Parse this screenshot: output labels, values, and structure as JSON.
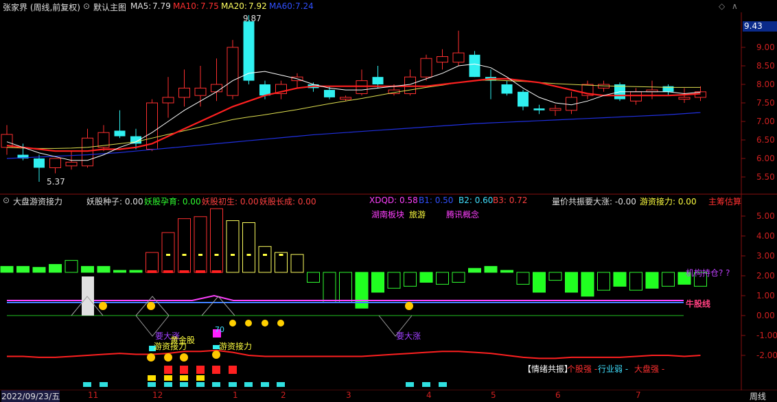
{
  "main_header": {
    "title": "张家界 (周线,前复权)",
    "chart_mode": "默认主图",
    "ma5_label": "MA5:",
    "ma5_value": "7.79",
    "ma10_label": "MA10:",
    "ma10_value": "7.75",
    "ma20_label": "MA20:",
    "ma20_value": "7.92",
    "ma60_label": "MA60:",
    "ma60_value": "7.24"
  },
  "price_axis": [
    "9.00",
    "8.50",
    "8.00",
    "7.50",
    "7.00",
    "6.50",
    "6.00",
    "5.50"
  ],
  "current_price_tag": "9.43",
  "annotations": {
    "high": "9.87",
    "low": "5.37"
  },
  "sub_header": {
    "indicator_name": "大盘游资接力",
    "yaogu_zhongzi": "妖股种子: 0.00",
    "yaogu_yunyu": "妖股孕育: 0.00",
    "yaogu_chusheng": "妖股初生: 0.00",
    "yaogu_zhangcheng": "妖股长成: 0.00",
    "xdqd": "XDQD: 0.58",
    "b1": "B1: 0.50",
    "b2": "B2: 0.60",
    "b3": "B3: 0.72",
    "liangjia": "量价共振要大涨: -0.00",
    "youzi": "游资接力: 0.00",
    "zhuchou": "主筹估算"
  },
  "sub_axis": [
    "5.00",
    "4.00",
    "3.00",
    "2.00",
    "1.00",
    "0.00",
    "-1.00",
    "-2.00"
  ],
  "sub_labels": {
    "hunan": "湖南板块",
    "lvyou": "旅游",
    "tengxun": "腾讯概念",
    "jigou": "机构持仓? ?",
    "niugu": "牛股线",
    "yaodazhang1": "要大涨",
    "yaodazhang2": "要大涨",
    "huangjin": "黄金股",
    "youzi1": "游资接力",
    "youzi2": "游资接力",
    "num70": "70",
    "qingxu": "【情绪共振】",
    "gegu": "个股强 -",
    "hangye": "行业弱 -",
    "dapan": "大盘强 -"
  },
  "time_axis": {
    "date": "2022/09/23/五",
    "ticks": [
      "11",
      "12",
      "1",
      "2",
      "3",
      "4",
      "5",
      "6",
      "7"
    ],
    "period": "周线"
  },
  "chart_data": {
    "type": "candlestick",
    "title": "张家界 (周线,前复权)",
    "ylim": [
      5.2,
      10.1
    ],
    "candles": [
      {
        "o": 6.3,
        "h": 6.9,
        "l": 6.1,
        "c": 6.65
      },
      {
        "o": 6.1,
        "h": 6.4,
        "l": 5.95,
        "c": 6.0
      },
      {
        "o": 6.0,
        "h": 6.1,
        "l": 5.37,
        "c": 5.75
      },
      {
        "o": 5.75,
        "h": 6.0,
        "l": 5.6,
        "c": 6.0
      },
      {
        "o": 5.8,
        "h": 6.2,
        "l": 5.7,
        "c": 5.9
      },
      {
        "o": 5.8,
        "h": 6.8,
        "l": 5.75,
        "c": 6.55
      },
      {
        "o": 6.3,
        "h": 6.9,
        "l": 6.2,
        "c": 6.7
      },
      {
        "o": 6.75,
        "h": 7.3,
        "l": 6.55,
        "c": 6.6
      },
      {
        "o": 6.6,
        "h": 6.8,
        "l": 6.25,
        "c": 6.4
      },
      {
        "o": 6.25,
        "h": 7.6,
        "l": 6.2,
        "c": 7.5
      },
      {
        "o": 7.5,
        "h": 8.2,
        "l": 7.1,
        "c": 7.65
      },
      {
        "o": 7.65,
        "h": 8.4,
        "l": 7.4,
        "c": 7.9
      },
      {
        "o": 7.7,
        "h": 8.5,
        "l": 7.4,
        "c": 7.9
      },
      {
        "o": 7.8,
        "h": 8.7,
        "l": 7.55,
        "c": 8.0
      },
      {
        "o": 7.7,
        "h": 9.2,
        "l": 7.6,
        "c": 9.0
      },
      {
        "o": 9.7,
        "h": 9.87,
        "l": 8.0,
        "c": 8.1
      },
      {
        "o": 8.0,
        "h": 8.1,
        "l": 7.6,
        "c": 7.7
      },
      {
        "o": 7.75,
        "h": 8.1,
        "l": 7.6,
        "c": 8.0
      },
      {
        "o": 8.1,
        "h": 8.3,
        "l": 7.9,
        "c": 8.2
      },
      {
        "o": 8.0,
        "h": 8.05,
        "l": 7.8,
        "c": 7.9
      },
      {
        "o": 7.85,
        "h": 7.95,
        "l": 7.6,
        "c": 7.65
      },
      {
        "o": 7.6,
        "h": 7.7,
        "l": 7.55,
        "c": 7.65
      },
      {
        "o": 7.75,
        "h": 8.4,
        "l": 7.7,
        "c": 8.1
      },
      {
        "o": 8.2,
        "h": 8.5,
        "l": 7.9,
        "c": 8.0
      },
      {
        "o": 7.75,
        "h": 8.0,
        "l": 7.7,
        "c": 7.85
      },
      {
        "o": 7.75,
        "h": 8.4,
        "l": 7.7,
        "c": 8.2
      },
      {
        "o": 8.2,
        "h": 8.8,
        "l": 8.1,
        "c": 8.7
      },
      {
        "o": 8.6,
        "h": 8.95,
        "l": 8.4,
        "c": 8.75
      },
      {
        "o": 8.6,
        "h": 9.45,
        "l": 8.5,
        "c": 8.85
      },
      {
        "o": 8.8,
        "h": 8.9,
        "l": 8.2,
        "c": 8.2
      },
      {
        "o": 8.2,
        "h": 8.4,
        "l": 7.6,
        "c": 8.1
      },
      {
        "o": 8.0,
        "h": 8.1,
        "l": 7.7,
        "c": 7.75
      },
      {
        "o": 7.8,
        "h": 7.85,
        "l": 7.3,
        "c": 7.4
      },
      {
        "o": 7.35,
        "h": 7.45,
        "l": 7.2,
        "c": 7.3
      },
      {
        "o": 7.3,
        "h": 7.45,
        "l": 7.15,
        "c": 7.35
      },
      {
        "o": 7.3,
        "h": 7.8,
        "l": 7.2,
        "c": 7.65
      },
      {
        "o": 7.7,
        "h": 8.1,
        "l": 7.6,
        "c": 8.0
      },
      {
        "o": 7.9,
        "h": 8.1,
        "l": 7.8,
        "c": 8.0
      },
      {
        "o": 8.0,
        "h": 8.05,
        "l": 7.55,
        "c": 7.6
      },
      {
        "o": 7.55,
        "h": 7.9,
        "l": 7.45,
        "c": 7.8
      },
      {
        "o": 7.8,
        "h": 8.1,
        "l": 7.6,
        "c": 7.85
      },
      {
        "o": 7.95,
        "h": 8.0,
        "l": 7.7,
        "c": 7.8
      },
      {
        "o": 7.6,
        "h": 7.9,
        "l": 7.5,
        "c": 7.65
      },
      {
        "o": 7.65,
        "h": 7.95,
        "l": 7.55,
        "c": 7.8
      }
    ],
    "ma5": [
      6.45,
      6.3,
      6.15,
      6.05,
      5.95,
      5.95,
      6.1,
      6.3,
      6.45,
      6.7,
      7.0,
      7.3,
      7.55,
      7.8,
      8.1,
      8.3,
      8.35,
      8.25,
      8.15,
      8.0,
      7.9,
      7.85,
      7.85,
      7.9,
      7.95,
      8.0,
      8.15,
      8.3,
      8.5,
      8.55,
      8.45,
      8.2,
      7.9,
      7.65,
      7.5,
      7.45,
      7.55,
      7.7,
      7.8,
      7.8,
      7.8,
      7.8,
      7.75,
      7.79
    ],
    "ma10": [
      6.35,
      6.3,
      6.25,
      6.2,
      6.2,
      6.2,
      6.25,
      6.25,
      6.3,
      6.4,
      6.6,
      6.8,
      7.0,
      7.2,
      7.4,
      7.55,
      7.7,
      7.8,
      7.9,
      7.95,
      7.95,
      7.95,
      7.95,
      7.95,
      7.95,
      7.95,
      7.95,
      8.0,
      8.05,
      8.1,
      8.15,
      8.15,
      8.1,
      8.05,
      7.95,
      7.85,
      7.75,
      7.7,
      7.7,
      7.7,
      7.7,
      7.7,
      7.72,
      7.75
    ],
    "ma20": [
      6.3,
      6.28,
      6.27,
      6.27,
      6.28,
      6.3,
      6.35,
      6.4,
      6.45,
      6.55,
      6.65,
      6.75,
      6.85,
      6.95,
      7.05,
      7.12,
      7.18,
      7.25,
      7.32,
      7.4,
      7.48,
      7.55,
      7.62,
      7.7,
      7.78,
      7.85,
      7.92,
      7.98,
      8.05,
      8.1,
      8.12,
      8.1,
      8.08,
      8.05,
      8.02,
      8.0,
      7.98,
      7.96,
      7.95,
      7.94,
      7.93,
      7.92,
      7.92,
      7.92
    ],
    "ma60": [
      6.0,
      6.02,
      6.04,
      6.06,
      6.08,
      6.1,
      6.13,
      6.16,
      6.2,
      6.24,
      6.28,
      6.32,
      6.36,
      6.4,
      6.44,
      6.48,
      6.52,
      6.56,
      6.6,
      6.64,
      6.67,
      6.7,
      6.73,
      6.76,
      6.79,
      6.82,
      6.85,
      6.88,
      6.91,
      6.94,
      6.96,
      6.98,
      7.0,
      7.02,
      7.04,
      7.06,
      7.08,
      7.1,
      7.12,
      7.14,
      7.16,
      7.18,
      7.21,
      7.24
    ],
    "volume_bars": [
      0.3,
      0.3,
      0.25,
      0.4,
      0.6,
      0.3,
      0.3,
      0.1,
      0.1,
      1.0,
      2.0,
      2.7,
      2.8,
      3.2,
      2.6,
      2.5,
      1.3,
      1.0,
      0.9,
      -0.5,
      -1.5,
      -1.5,
      -1.8,
      -1.0,
      -0.8,
      -0.7,
      -0.5,
      -0.6,
      -0.5,
      0.2,
      0.3,
      0.1,
      -0.6,
      -1.0,
      -0.4,
      -1.0,
      -1.2,
      -0.9,
      -0.7,
      -0.9,
      -0.8,
      -0.7,
      -0.6,
      -0.7
    ],
    "emotion_line": [
      -2.05,
      -2.05,
      -2.1,
      -2.1,
      -2.05,
      -2.0,
      -1.95,
      -1.9,
      -1.95,
      -1.95,
      -1.9,
      -1.8,
      -1.8,
      -1.75,
      -1.85,
      -2.0,
      -2.05,
      -2.05,
      -2.05,
      -2.05,
      -2.05,
      -2.05,
      -2.05,
      -2.0,
      -1.95,
      -1.9,
      -1.85,
      -1.8,
      -1.8,
      -1.85,
      -1.9,
      -2.0,
      -2.1,
      -2.15,
      -2.15,
      -2.1,
      -2.1,
      -2.1,
      -2.1,
      -2.05,
      -2.0,
      -2.0,
      -2.05,
      -2.0
    ]
  }
}
